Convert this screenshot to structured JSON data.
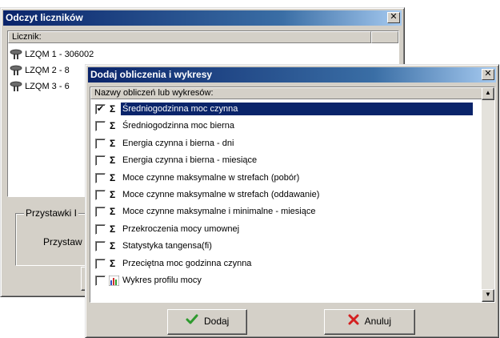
{
  "back_window": {
    "title": "Odczyt liczników",
    "close_glyph": "✕",
    "column_header": "Licznik:",
    "meters": [
      {
        "label": "LZQM 1 - 306002"
      },
      {
        "label": "LZQM 2 - 8"
      },
      {
        "label": "LZQM 3 - 6"
      }
    ],
    "group_label": "Przystawki I",
    "group_field_label": "Przystaw"
  },
  "dialog": {
    "title": "Dodaj obliczenia i wykresy",
    "close_glyph": "✕",
    "column_header": "Nazwy obliczeń lub wykresów:",
    "items": [
      {
        "label": "Średniogodzinna moc czynna",
        "checked": true,
        "selected": true,
        "icon": "sigma-icon",
        "glyph": "Σ"
      },
      {
        "label": "Średniogodzinna moc bierna",
        "checked": false,
        "selected": false,
        "icon": "sigma-icon",
        "glyph": "Σ"
      },
      {
        "label": "Energia czynna i bierna - dni",
        "checked": false,
        "selected": false,
        "icon": "sigma-icon",
        "glyph": "Σ"
      },
      {
        "label": "Energia czynna i bierna - miesiące",
        "checked": false,
        "selected": false,
        "icon": "sigma-icon",
        "glyph": "Σ"
      },
      {
        "label": "Moce czynne maksymalne w strefach (pobór)",
        "checked": false,
        "selected": false,
        "icon": "sigma-icon",
        "glyph": "Σ"
      },
      {
        "label": "Moce czynne maksymalne w strefach (oddawanie)",
        "checked": false,
        "selected": false,
        "icon": "sigma-icon",
        "glyph": "Σ"
      },
      {
        "label": "Moce czynne maksymalne i minimalne - miesiące",
        "checked": false,
        "selected": false,
        "icon": "sigma-icon",
        "glyph": "Σ"
      },
      {
        "label": "Przekroczenia mocy umownej",
        "checked": false,
        "selected": false,
        "icon": "sigma-icon",
        "glyph": "Σ"
      },
      {
        "label": "Statystyka tangensa(fi)",
        "checked": false,
        "selected": false,
        "icon": "sigma-icon",
        "glyph": "Σ"
      },
      {
        "label": "Przeciętna moc godzinna czynna",
        "checked": false,
        "selected": false,
        "icon": "sigma-icon",
        "glyph": "Σ"
      },
      {
        "label": "Wykres profilu mocy",
        "checked": false,
        "selected": false,
        "icon": "bar-chart-icon",
        "glyph": ""
      }
    ],
    "ok_button": "Dodaj",
    "cancel_button": "Anuluj",
    "colors": {
      "selection": "#0a246a",
      "ok_check": "#2e9a2e",
      "cancel_x": "#d42020"
    }
  }
}
